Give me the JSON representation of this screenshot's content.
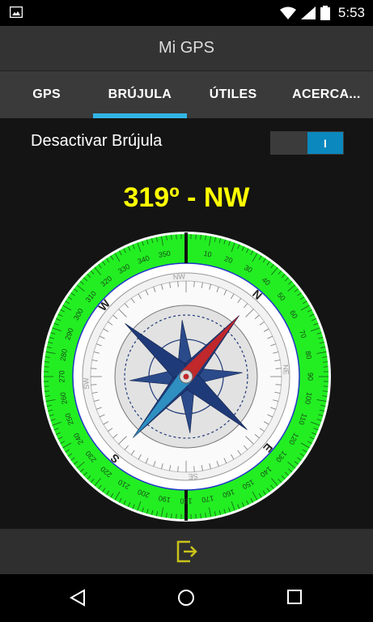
{
  "status": {
    "time": "5:53"
  },
  "app": {
    "title": "Mi GPS"
  },
  "tabs": [
    {
      "label": "GPS",
      "active": false
    },
    {
      "label": "BRÚJULA",
      "active": true
    },
    {
      "label": "ÚTILES",
      "active": false
    },
    {
      "label": "ACERCA...",
      "active": false
    }
  ],
  "compass_toggle": {
    "label": "Desactivar Brújula",
    "state_label": "I",
    "on": true
  },
  "heading": {
    "text": "319º - NW",
    "degrees": 319
  },
  "compass": {
    "outer_degree_labels": [
      "10",
      "20",
      "30",
      "40",
      "50",
      "60",
      "70",
      "80",
      "90",
      "100",
      "110",
      "120",
      "130",
      "140",
      "150",
      "160",
      "170",
      "180",
      "190",
      "200",
      "210",
      "220",
      "230",
      "240",
      "250",
      "260",
      "270",
      "280",
      "290",
      "300",
      "310",
      "320",
      "330",
      "340",
      "350"
    ],
    "cardinals": [
      "N",
      "E",
      "S",
      "W"
    ],
    "inner_labels": [
      "NW",
      "NE",
      "SE",
      "SW"
    ],
    "ring_color": "#22ee22",
    "needle_north_color": "#c0282b",
    "needle_south_color": "#2e8fc0"
  },
  "bottom_bar": {
    "icon": "exit-icon"
  },
  "navigation": {
    "icons": [
      "back-icon",
      "home-icon",
      "recents-icon"
    ]
  },
  "colors": {
    "accent": "#33b5e5",
    "heading": "#ffff00"
  }
}
